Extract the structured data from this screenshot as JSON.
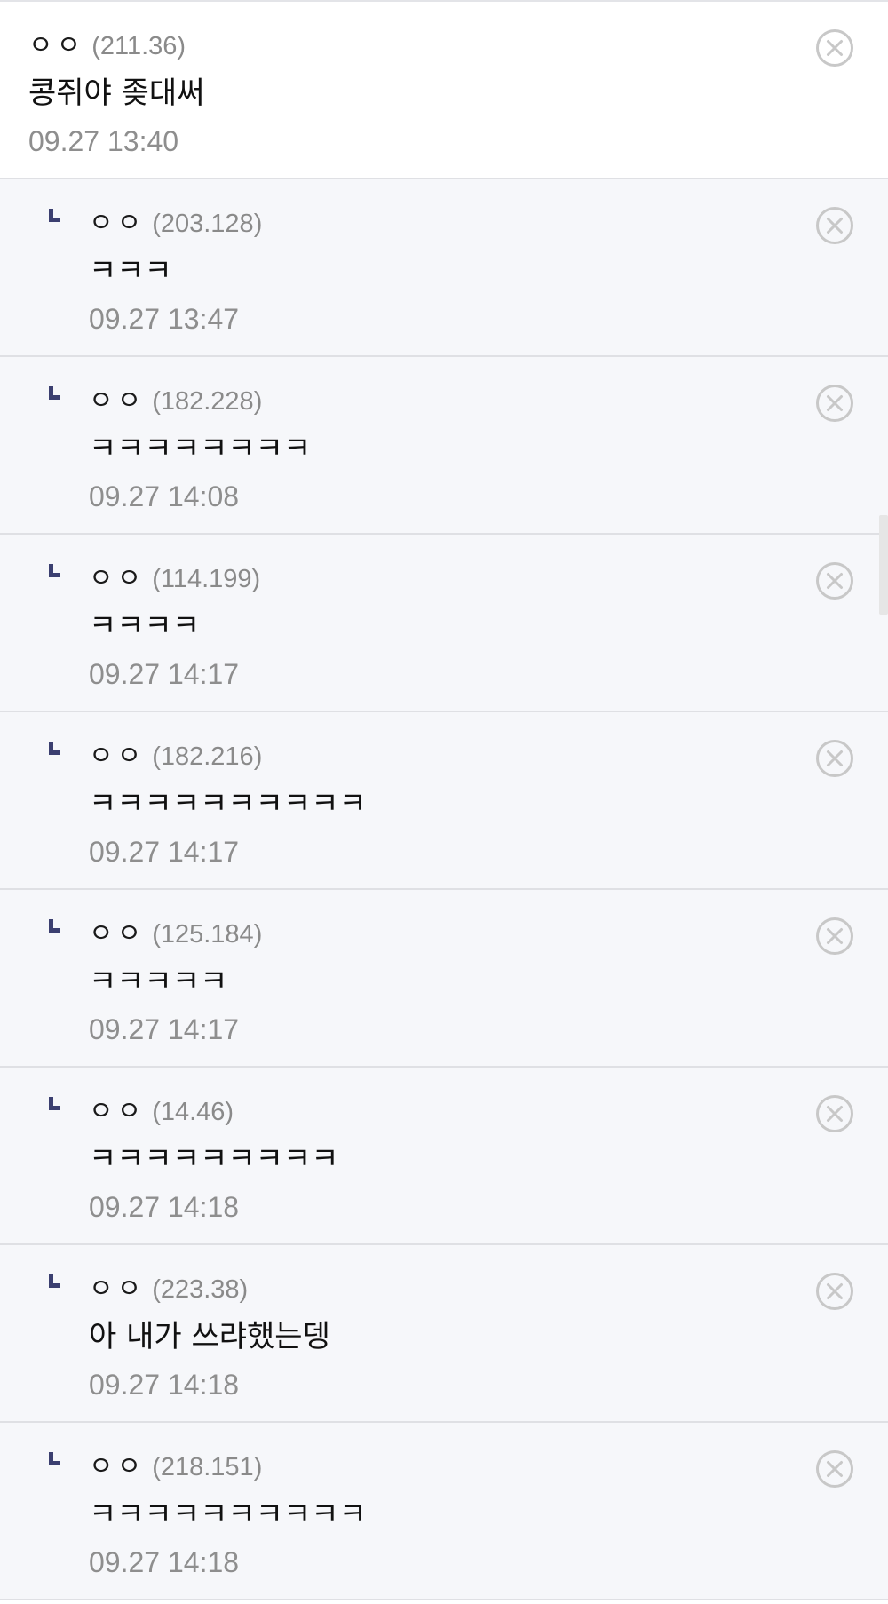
{
  "comments": [
    {
      "type": "top",
      "nick": "ㅇㅇ",
      "ip": "(211.36)",
      "text": "콩쥐야 좆대써",
      "date": "09.27 13:40"
    },
    {
      "type": "reply",
      "nick": "ㅇㅇ",
      "ip": "(203.128)",
      "text": "ㅋㅋㅋ",
      "date": "09.27 13:47"
    },
    {
      "type": "reply",
      "nick": "ㅇㅇ",
      "ip": "(182.228)",
      "text": "ㅋㅋㅋㅋㅋㅋㅋㅋ",
      "date": "09.27 14:08"
    },
    {
      "type": "reply",
      "nick": "ㅇㅇ",
      "ip": "(114.199)",
      "text": "ㅋㅋㅋㅋ",
      "date": "09.27 14:17"
    },
    {
      "type": "reply",
      "nick": "ㅇㅇ",
      "ip": "(182.216)",
      "text": "ㅋㅋㅋㅋㅋㅋㅋㅋㅋㅋ",
      "date": "09.27 14:17"
    },
    {
      "type": "reply",
      "nick": "ㅇㅇ",
      "ip": "(125.184)",
      "text": "ㅋㅋㅋㅋㅋ",
      "date": "09.27 14:17"
    },
    {
      "type": "reply",
      "nick": "ㅇㅇ",
      "ip": "(14.46)",
      "text": "ㅋㅋㅋㅋㅋㅋㅋㅋㅋ",
      "date": "09.27 14:18"
    },
    {
      "type": "reply",
      "nick": "ㅇㅇ",
      "ip": "(223.38)",
      "text": "아 내가 쓰랴했는뎅",
      "date": "09.27 14:18"
    },
    {
      "type": "reply",
      "nick": "ㅇㅇ",
      "ip": "(218.151)",
      "text": "ㅋㅋㅋㅋㅋㅋㅋㅋㅋㅋ",
      "date": "09.27 14:18"
    }
  ],
  "icons": {
    "delete": "close-circle-icon",
    "reply": "reply-arrow-icon"
  },
  "colors": {
    "reply_background": "#f6f7fa",
    "top_background": "#ffffff",
    "reply_marker": "#3b3f70",
    "meta_text": "#8e8e8e",
    "divider": "#dfe0e4"
  }
}
